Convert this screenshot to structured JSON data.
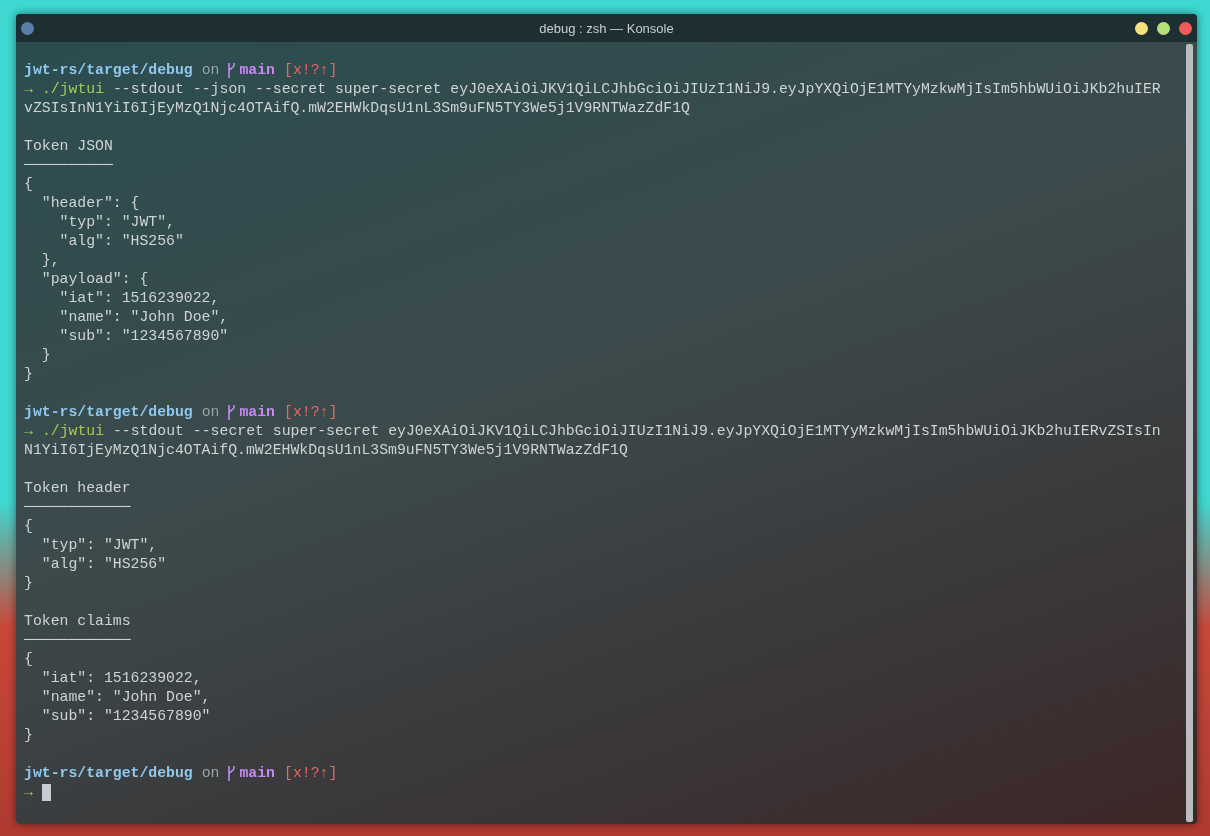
{
  "window": {
    "title": "debug : zsh — Konsole",
    "buttons": [
      {
        "kind": "menu",
        "color": "#5a7fa8"
      },
      {
        "kind": "minimize",
        "color": "#f5e07a"
      },
      {
        "kind": "maximize",
        "color": "#b8e07a"
      },
      {
        "kind": "close",
        "color": "#f05a5a"
      }
    ]
  },
  "terminal": {
    "lines": [
      {
        "kind": "blank"
      },
      {
        "kind": "prompt",
        "path": "jwt-rs/target/debug",
        "on": "on",
        "branch": "main",
        "status": "[x!?↑]"
      },
      {
        "kind": "command",
        "arrow": "→",
        "program": "./jwtui",
        "text": [
          " --stdout --json --secret super-secret eyJ0eXAiOiJKV1QiLCJhbGciOiJIUzI1NiJ9.eyJpYXQiOjE1MTYyMzkwMjIsIm5hbWUiOiJKb2huIER",
          "vZSIsInN1YiI6IjEyMzQ1Njc4OTAifQ.mW2EHWkDqsU1nL3Sm9uFN5TY3We5j1V9RNTWazZdF1Q"
        ]
      },
      {
        "kind": "blank"
      },
      {
        "kind": "output",
        "text": "Token JSON"
      },
      {
        "kind": "output",
        "text": "──────────"
      },
      {
        "kind": "output",
        "text": "{"
      },
      {
        "kind": "output",
        "text": "  \"header\": {"
      },
      {
        "kind": "output",
        "text": "    \"typ\": \"JWT\","
      },
      {
        "kind": "output",
        "text": "    \"alg\": \"HS256\""
      },
      {
        "kind": "output",
        "text": "  },"
      },
      {
        "kind": "output",
        "text": "  \"payload\": {"
      },
      {
        "kind": "output",
        "text": "    \"iat\": 1516239022,"
      },
      {
        "kind": "output",
        "text": "    \"name\": \"John Doe\","
      },
      {
        "kind": "output",
        "text": "    \"sub\": \"1234567890\""
      },
      {
        "kind": "output",
        "text": "  }"
      },
      {
        "kind": "output",
        "text": "}"
      },
      {
        "kind": "blank"
      },
      {
        "kind": "prompt",
        "path": "jwt-rs/target/debug",
        "on": "on",
        "branch": "main",
        "status": "[x!?↑]"
      },
      {
        "kind": "command",
        "arrow": "→",
        "program": "./jwtui",
        "text": [
          " --stdout --secret super-secret eyJ0eXAiOiJKV1QiLCJhbGciOiJIUzI1NiJ9.eyJpYXQiOjE1MTYyMzkwMjIsIm5hbWUiOiJKb2huIERvZSIsIn",
          "N1YiI6IjEyMzQ1Njc4OTAifQ.mW2EHWkDqsU1nL3Sm9uFN5TY3We5j1V9RNTWazZdF1Q"
        ]
      },
      {
        "kind": "blank"
      },
      {
        "kind": "output",
        "text": "Token header"
      },
      {
        "kind": "output",
        "text": "────────────"
      },
      {
        "kind": "output",
        "text": "{"
      },
      {
        "kind": "output",
        "text": "  \"typ\": \"JWT\","
      },
      {
        "kind": "output",
        "text": "  \"alg\": \"HS256\""
      },
      {
        "kind": "output",
        "text": "}"
      },
      {
        "kind": "blank"
      },
      {
        "kind": "output",
        "text": "Token claims"
      },
      {
        "kind": "output",
        "text": "────────────"
      },
      {
        "kind": "output",
        "text": "{"
      },
      {
        "kind": "output",
        "text": "  \"iat\": 1516239022,"
      },
      {
        "kind": "output",
        "text": "  \"name\": \"John Doe\","
      },
      {
        "kind": "output",
        "text": "  \"sub\": \"1234567890\""
      },
      {
        "kind": "output",
        "text": "}"
      },
      {
        "kind": "blank"
      },
      {
        "kind": "prompt",
        "path": "jwt-rs/target/debug",
        "on": "on",
        "branch": "main",
        "status": "[x!?↑]"
      },
      {
        "kind": "cursor",
        "arrow": "→"
      }
    ]
  }
}
